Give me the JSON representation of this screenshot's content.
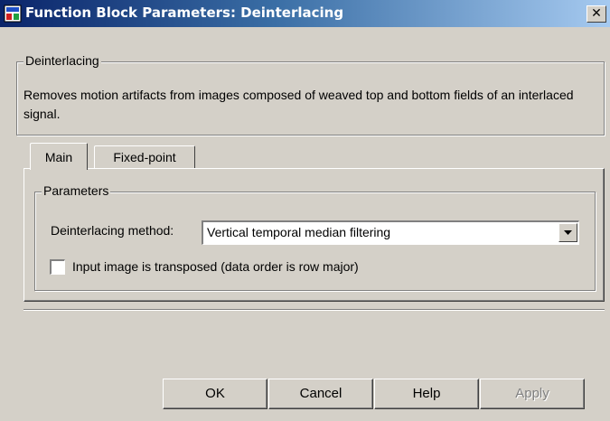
{
  "window": {
    "title": "Function Block Parameters: Deinterlacing",
    "close_glyph": "✕"
  },
  "block": {
    "group_title": "Deinterlacing",
    "description": "Removes motion artifacts from images composed of weaved top and bottom fields of an interlaced signal."
  },
  "tabs": [
    {
      "label": "Main",
      "selected": true
    },
    {
      "label": "Fixed-point",
      "selected": false
    }
  ],
  "parameters": {
    "group_title": "Parameters",
    "method_label": "Deinterlacing method:",
    "method_value": "Vertical temporal median filtering",
    "transposed_label": "Input image is transposed (data order is row major)",
    "transposed_checked": false
  },
  "buttons": {
    "ok": "OK",
    "cancel": "Cancel",
    "help": "Help",
    "apply": "Apply",
    "apply_enabled": false
  },
  "colors": {
    "title_gradient_start": "#0a246a",
    "title_gradient_end": "#a6caf0",
    "dialog_face": "#d4d0c8"
  }
}
